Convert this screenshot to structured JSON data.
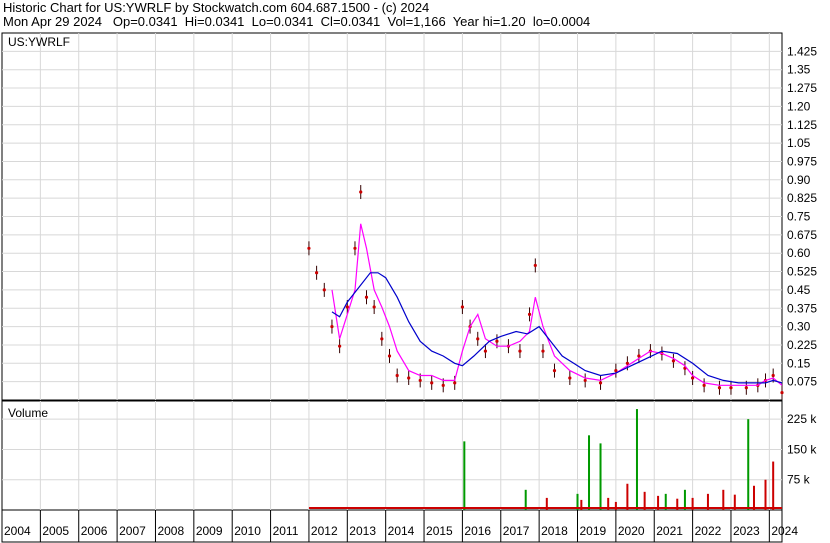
{
  "header": {
    "line1": "Historic Chart for US:YWRLF by Stockwatch.com 604.687.1500 - (c) 2024",
    "line2": "Mon Apr 29 2024   Op=0.0341  Hi=0.0341  Lo=0.0341  Cl=0.0341  Vol=1,166  Year hi=1.20  lo=0.0004"
  },
  "chart_data": [
    {
      "type": "line",
      "title": "US:YWRLF",
      "y_ticks": [
        "1.425",
        "1.35",
        "1.275",
        "1.20",
        "1.125",
        "1.05",
        "0.975",
        "0.90",
        "0.825",
        "0.75",
        "0.675",
        "0.60",
        "0.525",
        "0.45",
        "0.375",
        "0.30",
        "0.225",
        "0.15",
        "0.075"
      ],
      "ylim": [
        0,
        1.5
      ],
      "grid": true,
      "series": [
        {
          "color": "#cc0000",
          "x": [
            2012.0,
            2012.2,
            2012.4,
            2012.6,
            2012.8,
            2013.0,
            2013.2,
            2013.35,
            2013.5,
            2013.7,
            2013.9,
            2014.1,
            2014.3,
            2014.6,
            2014.9,
            2015.2,
            2015.5,
            2015.8,
            2016.0,
            2016.2,
            2016.4,
            2016.6,
            2016.9,
            2017.2,
            2017.5,
            2017.75,
            2017.9,
            2018.1,
            2018.4,
            2018.8,
            2019.2,
            2019.6,
            2020.0,
            2020.3,
            2020.6,
            2020.9,
            2021.2,
            2021.5,
            2021.8,
            2022.0,
            2022.3,
            2022.7,
            2023.0,
            2023.4,
            2023.7,
            2023.9,
            2024.1,
            2024.33
          ],
          "y": [
            0.62,
            0.52,
            0.45,
            0.3,
            0.22,
            0.38,
            0.62,
            0.85,
            0.42,
            0.38,
            0.25,
            0.18,
            0.1,
            0.09,
            0.08,
            0.07,
            0.06,
            0.07,
            0.38,
            0.3,
            0.25,
            0.2,
            0.24,
            0.22,
            0.2,
            0.35,
            0.55,
            0.2,
            0.12,
            0.09,
            0.08,
            0.07,
            0.12,
            0.15,
            0.18,
            0.2,
            0.19,
            0.16,
            0.13,
            0.09,
            0.06,
            0.05,
            0.05,
            0.05,
            0.06,
            0.08,
            0.1,
            0.03
          ]
        },
        {
          "color": "#ff00ff",
          "x": [
            2012.6,
            2012.8,
            2013.0,
            2013.2,
            2013.35,
            2013.5,
            2013.7,
            2013.9,
            2014.1,
            2014.3,
            2014.6,
            2014.9,
            2015.2,
            2015.5,
            2015.8,
            2016.0,
            2016.2,
            2016.4,
            2016.6,
            2016.9,
            2017.2,
            2017.5,
            2017.75,
            2017.9,
            2018.1,
            2018.4,
            2018.8,
            2019.2,
            2019.6,
            2020.0,
            2020.3,
            2020.6,
            2020.9,
            2021.2,
            2021.5,
            2021.8,
            2022.0,
            2022.3,
            2022.7,
            2023.0,
            2023.4,
            2023.7,
            2023.9,
            2024.1,
            2024.33
          ],
          "y": [
            0.45,
            0.25,
            0.35,
            0.45,
            0.72,
            0.62,
            0.45,
            0.38,
            0.3,
            0.2,
            0.12,
            0.1,
            0.1,
            0.08,
            0.08,
            0.2,
            0.3,
            0.35,
            0.25,
            0.22,
            0.22,
            0.24,
            0.28,
            0.42,
            0.3,
            0.18,
            0.12,
            0.09,
            0.08,
            0.11,
            0.14,
            0.17,
            0.2,
            0.19,
            0.17,
            0.14,
            0.1,
            0.07,
            0.06,
            0.06,
            0.06,
            0.06,
            0.08,
            0.09,
            0.06
          ]
        },
        {
          "color": "#0000cc",
          "x": [
            2012.6,
            2012.8,
            2013.0,
            2013.3,
            2013.6,
            2013.8,
            2014.0,
            2014.3,
            2014.6,
            2014.9,
            2015.2,
            2015.5,
            2015.8,
            2016.0,
            2016.3,
            2016.7,
            2017.0,
            2017.4,
            2017.7,
            2018.0,
            2018.3,
            2018.6,
            2018.9,
            2019.2,
            2019.6,
            2020.0,
            2020.4,
            2020.8,
            2021.2,
            2021.6,
            2022.0,
            2022.4,
            2022.8,
            2023.2,
            2023.6,
            2023.9,
            2024.1,
            2024.33
          ],
          "y": [
            0.36,
            0.34,
            0.4,
            0.46,
            0.52,
            0.52,
            0.5,
            0.42,
            0.32,
            0.24,
            0.2,
            0.18,
            0.15,
            0.14,
            0.18,
            0.24,
            0.26,
            0.28,
            0.27,
            0.3,
            0.24,
            0.18,
            0.15,
            0.12,
            0.1,
            0.11,
            0.14,
            0.17,
            0.2,
            0.19,
            0.15,
            0.1,
            0.08,
            0.07,
            0.07,
            0.07,
            0.08,
            0.07
          ]
        }
      ]
    },
    {
      "type": "bar",
      "title": "Volume",
      "y_ticks": [
        "225 k",
        "150 k",
        "75 k"
      ],
      "ylim": [
        0,
        270000
      ],
      "x": [
        "2004",
        "2005",
        "2006",
        "2007",
        "2008",
        "2009",
        "2010",
        "2011",
        "2012",
        "2013",
        "2014",
        "2015",
        "2016",
        "2017",
        "2018",
        "2019",
        "2020",
        "2021",
        "2022",
        "2023",
        "2024"
      ],
      "series": [
        {
          "color": "#009900",
          "bars": [
            {
              "x": 2016.05,
              "value": 170000
            },
            {
              "x": 2017.65,
              "value": 50000
            },
            {
              "x": 2019.0,
              "value": 40000
            },
            {
              "x": 2019.3,
              "value": 185000
            },
            {
              "x": 2019.6,
              "value": 165000
            },
            {
              "x": 2020.55,
              "value": 250000
            },
            {
              "x": 2021.3,
              "value": 40000
            },
            {
              "x": 2021.8,
              "value": 50000
            },
            {
              "x": 2023.45,
              "value": 225000
            }
          ]
        },
        {
          "color": "#cc0000",
          "bars": [
            {
              "x": 2018.2,
              "value": 30000
            },
            {
              "x": 2019.1,
              "value": 25000
            },
            {
              "x": 2019.8,
              "value": 30000
            },
            {
              "x": 2020.0,
              "value": 20000
            },
            {
              "x": 2020.3,
              "value": 65000
            },
            {
              "x": 2020.75,
              "value": 45000
            },
            {
              "x": 2021.1,
              "value": 35000
            },
            {
              "x": 2021.6,
              "value": 28000
            },
            {
              "x": 2022.0,
              "value": 30000
            },
            {
              "x": 2022.4,
              "value": 40000
            },
            {
              "x": 2022.8,
              "value": 50000
            },
            {
              "x": 2023.1,
              "value": 38000
            },
            {
              "x": 2023.6,
              "value": 60000
            },
            {
              "x": 2023.9,
              "value": 75000
            },
            {
              "x": 2024.1,
              "value": 120000
            }
          ]
        }
      ]
    }
  ]
}
